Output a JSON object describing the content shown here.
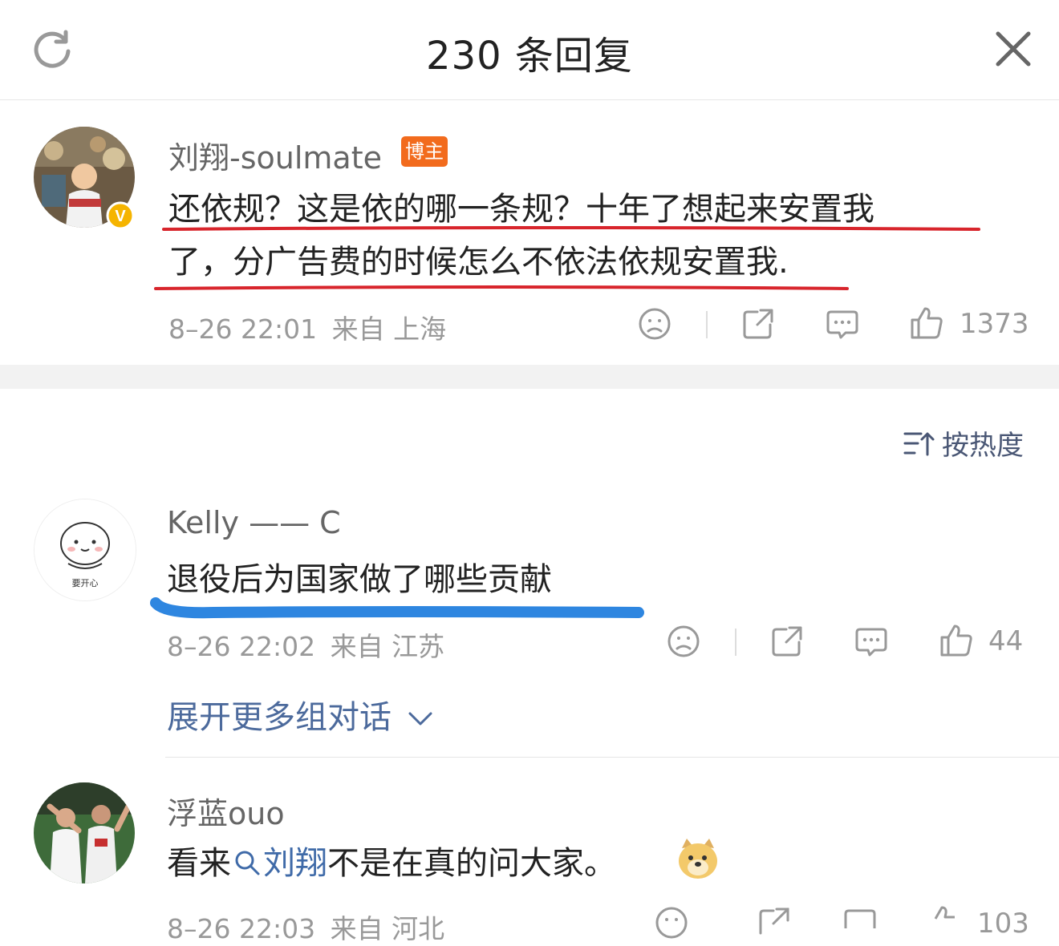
{
  "header": {
    "title": "230 条回复",
    "refresh_icon": "refresh-icon",
    "close_icon": "close-icon"
  },
  "main_post": {
    "author": "刘翔-soulmate",
    "badge": "博主",
    "verified_badge": "V",
    "text_line1": "还依规？这是依的哪一条规？十年了想起来安置我",
    "text_line2": "了，分广告费的时候怎么不依法依规安置我.",
    "time": "8–26 22:01",
    "location": "来自 上海",
    "likes": "1373",
    "underline_color": "#d8252c"
  },
  "sort": {
    "label": "按热度",
    "icon": "sort-icon"
  },
  "comments": [
    {
      "author": "Kelly —— C",
      "avatar_text": "要开心",
      "text": "退役后为国家做了哪些贡献",
      "time": "8–26 22:02",
      "location": "来自 江苏",
      "likes": "44",
      "underline_color": "#2e86e0"
    },
    {
      "author": "浮蓝ouo",
      "text_before": "看来",
      "topic_link": "刘翔",
      "text_after": "不是在真的问大家。",
      "emoji": "doge-emoji",
      "time": "8–26 22:03",
      "location": "来自 河北",
      "likes": "103"
    }
  ],
  "expand_label": "展开更多组对话",
  "colors": {
    "badge_orange": "#f26b1d",
    "verified_yellow": "#f5b400",
    "meta_gray": "#999999",
    "link_blue": "#3f6aa8"
  }
}
